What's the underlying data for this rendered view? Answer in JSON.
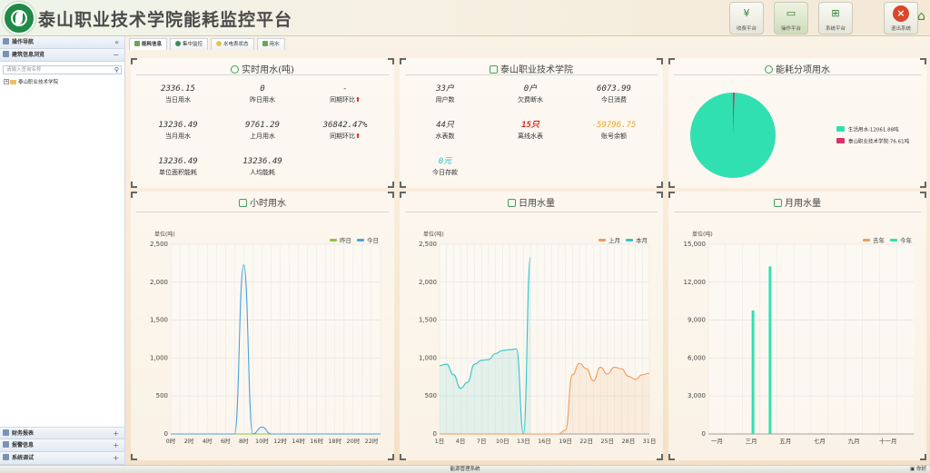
{
  "app": {
    "title": "泰山职业技术学院能耗监控平台"
  },
  "toolbar": [
    {
      "label": "收费平台",
      "icon": "yen-icon",
      "active": false
    },
    {
      "label": "操作平台",
      "icon": "monitor-icon",
      "active": true
    },
    {
      "label": "系统平台",
      "icon": "network-icon",
      "active": false
    },
    {
      "label": "退出系统",
      "icon": "close-icon",
      "active": false
    }
  ],
  "sidebar": {
    "nav_label": "操作导航",
    "collapse_icon": "double-chevron-left-icon",
    "section": "建筑信息浏览",
    "search_placeholder": "请输入查询名称",
    "tree_root": "泰山职业技术学院",
    "bottom": [
      "财务报表",
      "报警信息",
      "系统调试"
    ]
  },
  "tabs": [
    "能耗信息",
    "集中监控",
    "水电表状态",
    "用水"
  ],
  "realtime": {
    "title": "实时用水(吨)",
    "stats": [
      {
        "value": "2336.15",
        "label": "当日用水"
      },
      {
        "value": "0",
        "label": "昨日用水"
      },
      {
        "value": "-",
        "label": "同期环比"
      },
      {
        "value": "13236.49",
        "label": "当月用水"
      },
      {
        "value": "9761.29",
        "label": "上月用水"
      },
      {
        "value": "36842.47%",
        "label": "同期环比"
      },
      {
        "value": "13236.49",
        "label": "单位面积能耗"
      },
      {
        "value": "13236.49",
        "label": "人均能耗"
      }
    ]
  },
  "school": {
    "title": "泰山职业技术学院",
    "stats": [
      {
        "value": "33户",
        "label": "用户数"
      },
      {
        "value": "0户",
        "label": "欠费断水"
      },
      {
        "value": "6073.99",
        "label": "今日消费"
      },
      {
        "value": "44只",
        "label": "水表数"
      },
      {
        "value": "15只",
        "label": "离线水表"
      },
      {
        "value": "-59796.75",
        "label": "账号余额"
      },
      {
        "value": "0元",
        "label": "今日存款"
      }
    ]
  },
  "pie": {
    "title": "能耗分项用水",
    "legend": [
      "生活用水:12061.88吨",
      "泰山职业技术学院:76.61吨"
    ]
  },
  "colors": {
    "accent": "#3da25f",
    "green": "#8dc63f",
    "blue": "#4aa3df",
    "orange": "#f29b5b",
    "cyan": "#35c4c9",
    "teal": "#31e0b0",
    "pink": "#d6336c",
    "red": "#d8271f"
  },
  "status_bar": {
    "center": "能源管理系统",
    "right": "你好"
  },
  "chart_data": [
    {
      "type": "line",
      "title": "小时用水",
      "ylabel": "单位(吨)",
      "ylim": [
        0,
        2500
      ],
      "yticks": [
        "0",
        "500",
        "1,000",
        "1,500",
        "2,000",
        "2,500"
      ],
      "x": [
        "0时",
        "1时",
        "2时",
        "3时",
        "4时",
        "5时",
        "6时",
        "7时",
        "8时",
        "9时",
        "10时",
        "11时",
        "12时",
        "13时",
        "14时",
        "15时",
        "16时",
        "17时",
        "18时",
        "19时",
        "20时",
        "21时",
        "22时",
        "23时"
      ],
      "xticklabels": [
        "0时",
        "2时",
        "4时",
        "6时",
        "8时",
        "10时",
        "12时",
        "14时",
        "16时",
        "18时",
        "20时",
        "22时"
      ],
      "legend": "top-right",
      "grid": true,
      "series": [
        {
          "name": "昨日",
          "values": [
            0,
            0,
            0,
            0,
            0,
            0,
            0,
            0,
            0,
            0,
            0,
            0,
            0,
            0,
            0,
            0,
            0,
            0,
            0,
            0,
            0,
            0,
            0,
            0
          ]
        },
        {
          "name": "今日",
          "values": [
            0,
            0,
            0,
            0,
            0,
            0,
            0,
            0,
            2230,
            0,
            90,
            0,
            0,
            0,
            0,
            0,
            0,
            0,
            0,
            0,
            0,
            0,
            0,
            0
          ]
        }
      ]
    },
    {
      "type": "area",
      "title": "日用水量",
      "ylabel": "单位(吨)",
      "ylim": [
        0,
        2500
      ],
      "yticks": [
        "0",
        "500",
        "1,000",
        "1,500",
        "2,000",
        "2,500"
      ],
      "x": [
        "1日",
        "2日",
        "3日",
        "4日",
        "5日",
        "6日",
        "7日",
        "8日",
        "9日",
        "10日",
        "11日",
        "12日",
        "13日",
        "14日",
        "15日",
        "16日",
        "17日",
        "18日",
        "19日",
        "20日",
        "21日",
        "22日",
        "23日",
        "24日",
        "25日",
        "26日",
        "27日",
        "28日",
        "29日",
        "30日",
        "31日"
      ],
      "xticklabels": [
        "1日",
        "4日",
        "7日",
        "10日",
        "13日",
        "16日",
        "19日",
        "22日",
        "25日",
        "28日",
        "31日"
      ],
      "legend": "top-right",
      "grid": true,
      "series": [
        {
          "name": "上月",
          "values": [
            0,
            0,
            0,
            0,
            0,
            0,
            0,
            0,
            0,
            0,
            0,
            0,
            0,
            0,
            0,
            0,
            0,
            0,
            50,
            780,
            930,
            860,
            700,
            880,
            790,
            880,
            860,
            760,
            720,
            780,
            800
          ]
        },
        {
          "name": "本月",
          "values": [
            900,
            920,
            780,
            600,
            680,
            920,
            970,
            980,
            1060,
            1100,
            1110,
            1120,
            0,
            2330,
            null,
            null,
            null,
            null,
            null,
            null,
            null,
            null,
            null,
            null,
            null,
            null,
            null,
            null,
            null,
            null,
            null
          ]
        }
      ]
    },
    {
      "type": "bar",
      "title": "月用水量",
      "ylabel": "单位(吨)",
      "ylim": [
        0,
        15000
      ],
      "yticks": [
        "0",
        "3,000",
        "6,000",
        "9,000",
        "12,000",
        "15,000"
      ],
      "categories": [
        "一月",
        "二月",
        "三月",
        "四月",
        "五月",
        "六月",
        "七月",
        "八月",
        "九月",
        "十月",
        "十一月",
        "十二月"
      ],
      "xticklabels": [
        "一月",
        "三月",
        "五月",
        "七月",
        "九月",
        "十一月"
      ],
      "legend": "top-right",
      "grid": true,
      "series": [
        {
          "name": "去年",
          "values": [
            0,
            0,
            0,
            0,
            0,
            0,
            0,
            0,
            0,
            0,
            0,
            0
          ]
        },
        {
          "name": "今年",
          "values": [
            0,
            0,
            9761,
            13236,
            0,
            0,
            0,
            0,
            0,
            0,
            0,
            0
          ]
        }
      ]
    }
  ]
}
